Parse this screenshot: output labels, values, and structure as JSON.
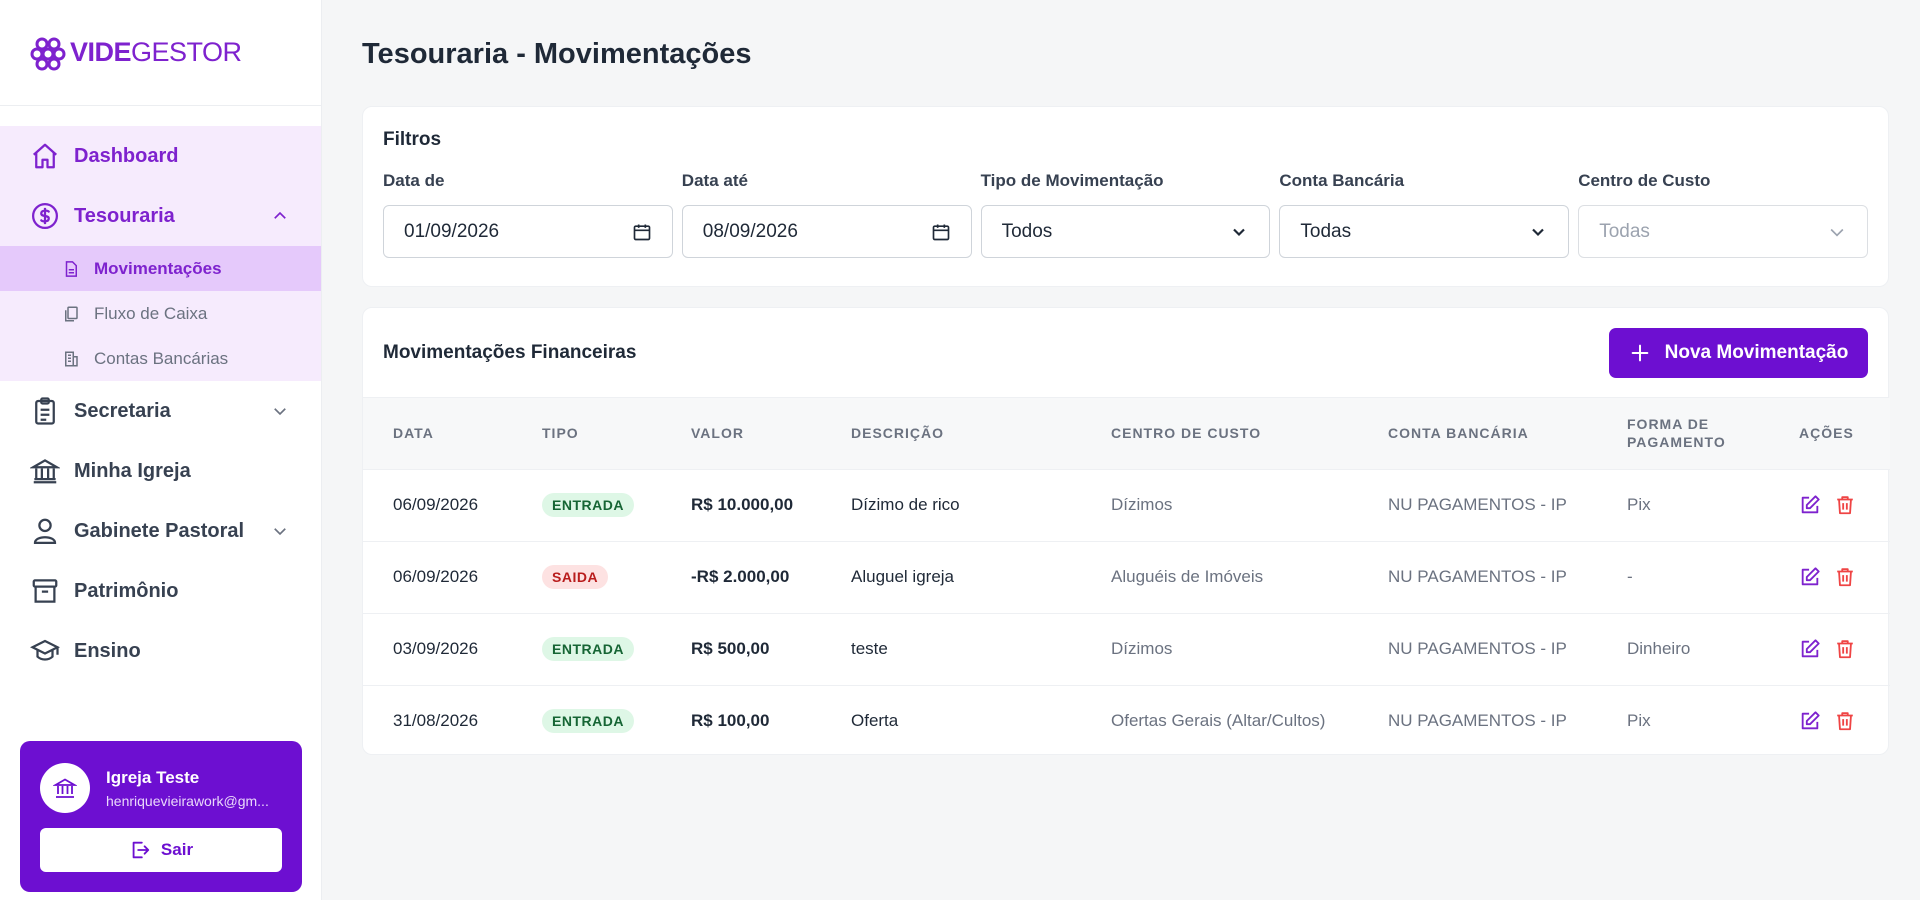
{
  "brand": {
    "bold": "VIDE",
    "light": "GESTOR",
    "color": "#7e22ce"
  },
  "nav": {
    "dashboard": "Dashboard",
    "tesouraria": "Tesouraria",
    "sub": [
      "Movimentações",
      "Fluxo de Caixa",
      "Contas Bancárias"
    ],
    "secretaria": "Secretaria",
    "minha_igreja": "Minha Igreja",
    "gabinete": "Gabinete Pastoral",
    "patrimonio": "Patrimônio",
    "ensino": "Ensino"
  },
  "user": {
    "name": "Igreja Teste",
    "email": "henriquevieirawork@gm...",
    "logout": "Sair"
  },
  "page": {
    "title": "Tesouraria - Movimentações"
  },
  "filters": {
    "title": "Filtros",
    "date_from_label": "Data de",
    "date_from": "01/09/2026",
    "date_to_label": "Data até",
    "date_to": "08/09/2026",
    "type_label": "Tipo de Movimentação",
    "type_value": "Todos",
    "account_label": "Conta Bancária",
    "account_value": "Todas",
    "cost_label": "Centro de Custo",
    "cost_value": "Todas"
  },
  "table": {
    "title": "Movimentações Financeiras",
    "new_button": "Nova Movimentação",
    "headers": [
      "DATA",
      "TIPO",
      "VALOR",
      "DESCRIÇÃO",
      "CENTRO DE CUSTO",
      "CONTA BANCÁRIA",
      "FORMA DE PAGAMENTO",
      "AÇÕES"
    ],
    "rows": [
      {
        "date": "06/09/2026",
        "type": "ENTRADA",
        "amount": "R$ 10.000,00",
        "desc": "Dízimo de rico",
        "cost": "Dízimos",
        "account": "NU PAGAMENTOS - IP",
        "payment": "Pix"
      },
      {
        "date": "06/09/2026",
        "type": "SAIDA",
        "amount": "-R$ 2.000,00",
        "desc": "Aluguel igreja",
        "cost": "Aluguéis de Imóveis",
        "account": "NU PAGAMENTOS - IP",
        "payment": "-"
      },
      {
        "date": "03/09/2026",
        "type": "ENTRADA",
        "amount": "R$ 500,00",
        "desc": "teste",
        "cost": "Dízimos",
        "account": "NU PAGAMENTOS - IP",
        "payment": "Dinheiro"
      },
      {
        "date": "31/08/2026",
        "type": "ENTRADA",
        "amount": "R$ 100,00",
        "desc": "Oferta",
        "cost": "Ofertas Gerais (Altar/Cultos)",
        "account": "NU PAGAMENTOS - IP",
        "payment": "Pix"
      }
    ]
  },
  "colors": {
    "accent": "#6d0fd1",
    "entrada_bg": "#def7e6",
    "saida_bg": "#fde2e2",
    "edit_icon": "#7e22ce",
    "delete_icon": "#ef4444"
  }
}
